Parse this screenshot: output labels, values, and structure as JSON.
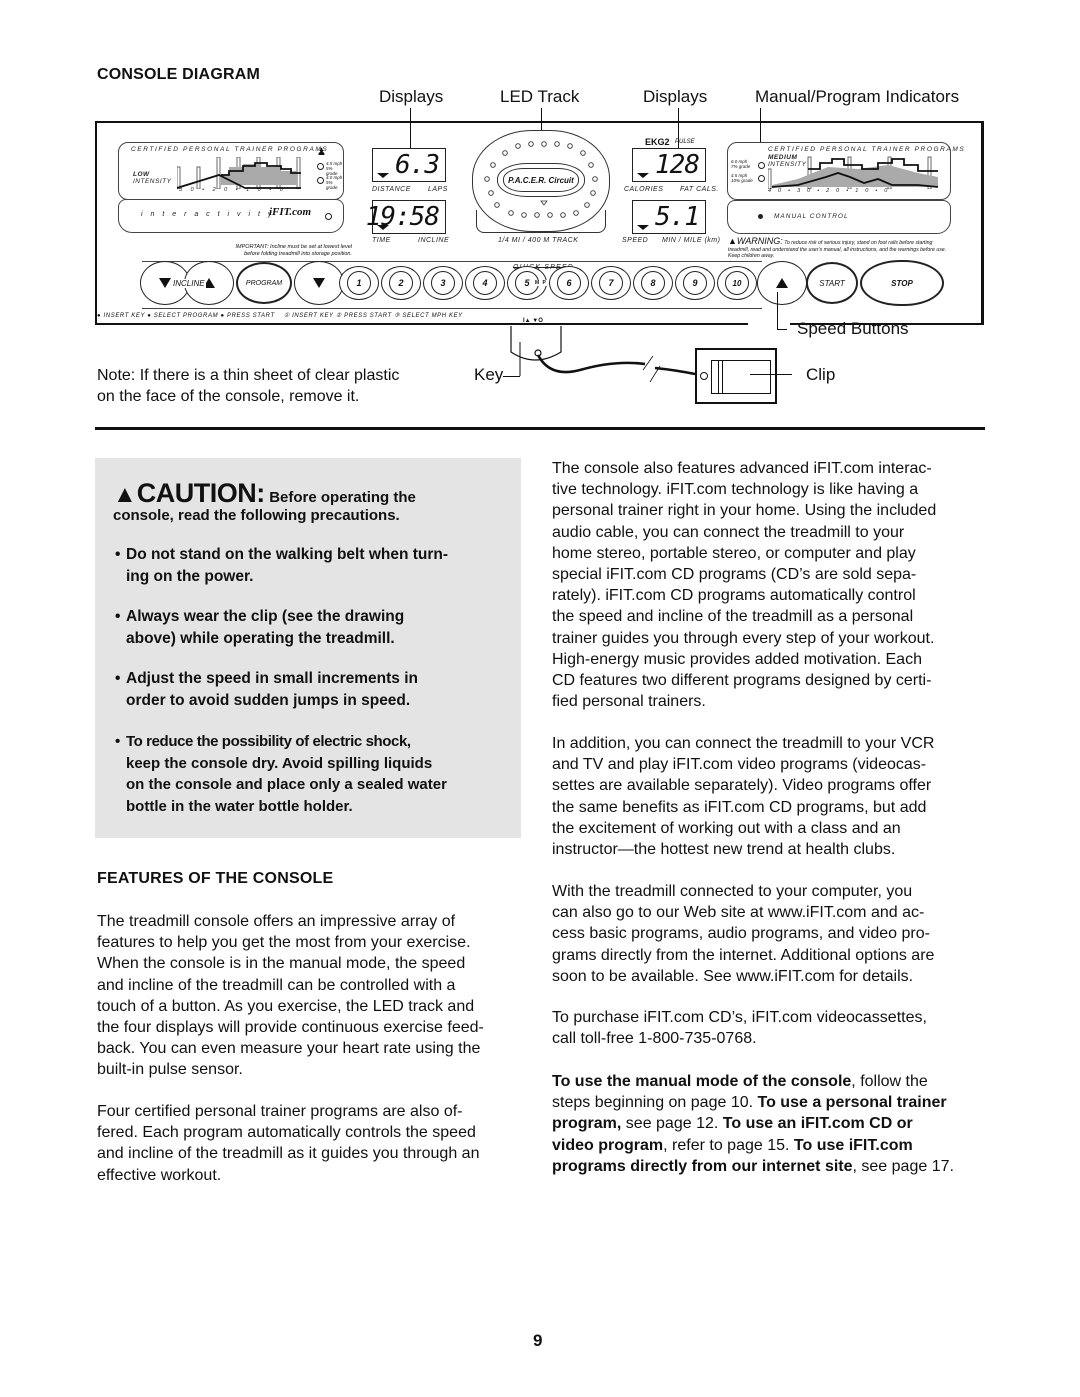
{
  "page": {
    "number": "9"
  },
  "diagram": {
    "heading": "CONSOLE DIAGRAM",
    "callouts": {
      "displays_left": "Displays",
      "led_track": "LED Track",
      "displays_right": "Displays",
      "manual_program_indicators": "Manual/Program Indicators",
      "speed_buttons": "Speed Buttons",
      "key": "Key",
      "clip": "Clip"
    },
    "note": {
      "line1": "Note: If there is a thin sheet of clear plastic",
      "line2": "on the face of the console, remove it."
    },
    "console": {
      "left_program_panel": {
        "title": "CERTIFIED PERSONAL TRAINER PROGRAMS",
        "intensity_line1": "LOW",
        "intensity_line2": "INTENSITY",
        "indicator1_line1": "4.5 mph",
        "indicator1_line2": "5% grade",
        "indicator2_line1": "4.0 mph",
        "indicator2_line2": "5% grade",
        "axis_ticks": [
          "30",
          "•",
          "20",
          "•",
          "10",
          "•",
          "0"
        ]
      },
      "interactivity_panel": {
        "label": "i n t e r a c t i v i t y",
        "logo": "iFIT.com"
      },
      "important_note": {
        "line1": "IMPORTANT: Incline must be set at lowest level",
        "line2": "before folding treadmill into storage position."
      },
      "displays": [
        {
          "value": "6.3",
          "label_left": "DISTANCE",
          "label_right": "LAPS"
        },
        {
          "value": "19:58",
          "label_left": "TIME",
          "label_right": "INCLINE"
        },
        {
          "value": "128",
          "label_left": "CALORIES",
          "label_right": "FAT CALS."
        },
        {
          "value": "5.1",
          "label_left": "SPEED",
          "label_right": "MIN / MILE (km)"
        }
      ],
      "led_track": {
        "logo": "P.A.C.E.R. Circuit",
        "caption": "1/4 MI / 400 M TRACK"
      },
      "pulse": {
        "brand": "EKG2",
        "label": "PULSE"
      },
      "right_program_panel": {
        "title": "CERTIFIED PERSONAL TRAINER PROGRAMS",
        "intensity_line1": "MEDIUM",
        "intensity_line2": "INTENSITY",
        "indicator1_line1": "6.0 mph",
        "indicator1_line2": "7% grade",
        "indicator2_line1": "4.5 mph",
        "indicator2_line2": "10% grade",
        "axis_ticks": [
          "40",
          "•",
          "30",
          "•",
          "20",
          "•",
          "10",
          "•",
          "0"
        ]
      },
      "manual_control_label": "MANUAL CONTROL",
      "warning": {
        "label": "WARNING:",
        "text": "To reduce risk of serious injury, stand on foot rails before starting treadmill, read and understand the user's manual, all instructions, and the warnings before use.  Keep children away."
      },
      "quick_speed_label": "QUICK SPEED",
      "mph_label": "M P H",
      "buttons": {
        "incline": "INCLINE",
        "program": "PROGRAM",
        "speed_numbers": [
          "1",
          "2",
          "3",
          "4",
          "5",
          "6",
          "7",
          "8",
          "9",
          "10"
        ],
        "start": "START",
        "stop": "STOP"
      },
      "instructions": {
        "program_steps": [
          "INSERT KEY",
          "SELECT PROGRAM",
          "PRESS START"
        ],
        "manual_steps": [
          "INSERT KEY",
          "PRESS START",
          "SELECT MPH KEY"
        ]
      },
      "key_slot_symbols": "I▲  ▼O"
    }
  },
  "caution": {
    "word": "CAUTION:",
    "intro_inline": "Before operating the",
    "intro_line2": "console, read the following precautions.",
    "bullets": [
      {
        "line1": "Do not stand on the walking belt when turn-",
        "line2": "ing on the power."
      },
      {
        "line1": "Always wear the clip (see the drawing",
        "line2": "above) while operating the treadmill."
      },
      {
        "line1": "Adjust the speed in small increments in",
        "line2": "order to avoid sudden jumps in speed."
      },
      {
        "line1": "To reduce the possibility of electric shock,",
        "line2": "keep the console dry. Avoid spilling liquids",
        "line3": "on the console and place only a sealed water",
        "line4": "bottle in the water bottle holder."
      }
    ]
  },
  "features": {
    "heading": "FEATURES OF THE CONSOLE",
    "paragraph1": [
      "The treadmill console offers an impressive array of",
      "features to help you get the most from your exercise.",
      "When the console is in the manual mode, the speed",
      "and incline of the treadmill can be controlled with a",
      "touch of a button. As you exercise, the LED track and",
      "the four displays will provide continuous exercise feed-",
      "back. You can even measure your heart rate using the",
      "built-in pulse sensor."
    ],
    "paragraph2": [
      "Four certified personal trainer programs are also of-",
      "fered. Each program automatically controls the speed",
      "and incline of the treadmill as it guides you through an",
      "effective workout."
    ]
  },
  "right_column": {
    "paragraph1": [
      "The console also features advanced iFIT.com interac-",
      "tive technology. iFIT.com technology is like having a",
      "personal trainer right in your home. Using the included",
      "audio cable, you can connect the treadmill to your",
      "home stereo, portable stereo, or computer and play",
      "special iFIT.com CD programs (CD’s are sold sepa-",
      "rately). iFIT.com CD programs automatically control",
      "the speed and incline of the treadmill as a personal",
      "trainer guides you through every step of your workout.",
      "High-energy music provides added motivation. Each",
      "CD features two different programs designed by certi-",
      "fied personal trainers."
    ],
    "paragraph2": [
      "In addition, you can connect the treadmill to your VCR",
      "and TV and play iFIT.com video programs (videocas-",
      "settes are available separately). Video programs offer",
      "the same benefits as iFIT.com CD programs, but add",
      "the excitement of working out with a class and an",
      "instructor—the hottest new trend at health clubs."
    ],
    "paragraph3": [
      "With the treadmill connected to your computer, you",
      "can also go to our Web site at www.iFIT.com and ac-",
      "cess basic programs, audio programs, and video pro-",
      "grams directly from the internet. Additional options are",
      "soon to be available. See www.iFIT.com for details."
    ],
    "paragraph4": [
      "To purchase iFIT.com CD’s, iFIT.com videocassettes,",
      "call toll-free 1-800-735-0768."
    ],
    "paragraph5": {
      "b1": "To use the manual mode of the console",
      "t1": ", follow the",
      "t2": "steps beginning on page 10. ",
      "b2": "To use a personal trainer",
      "b3": "program,",
      "t3": " see page 12. ",
      "b4": "To use an iFIT.com CD or",
      "b5": "video program",
      "t4": ", refer to page 15. ",
      "b6": "To use iFIT.com",
      "b7": "programs directly from our internet site",
      "t5": ", see page 17."
    }
  }
}
